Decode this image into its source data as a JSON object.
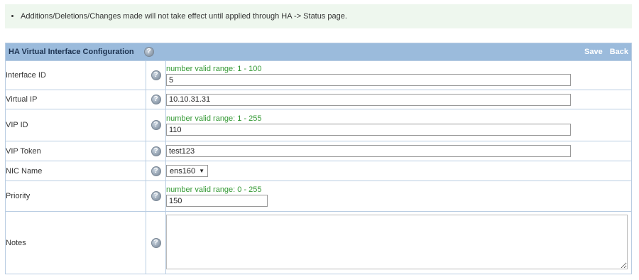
{
  "notice": "Additions/Deletions/Changes made will not take effect until applied through HA -> Status page.",
  "header": {
    "title": "HA Virtual Interface Configuration",
    "help_icon": "question-circle-icon",
    "save_label": "Save",
    "back_label": "Back"
  },
  "rows": {
    "interface_id": {
      "label": "Interface ID",
      "hint": "number valid range: 1 - 100",
      "value": "5"
    },
    "virtual_ip": {
      "label": "Virtual IP",
      "value": "10.10.31.31"
    },
    "vip_id": {
      "label": "VIP ID",
      "hint": "number valid range: 1 - 255",
      "value": "110"
    },
    "vip_token": {
      "label": "VIP Token",
      "value": "test123"
    },
    "nic_name": {
      "label": "NIC Name",
      "selected": "ens160"
    },
    "priority": {
      "label": "Priority",
      "hint": "number valid range: 0 - 255",
      "value": "150"
    },
    "notes": {
      "label": "Notes",
      "value": ""
    }
  },
  "colors": {
    "header_bg": "#9bbbdc",
    "hint": "#339933",
    "notice_bg": "#eef7ee"
  }
}
